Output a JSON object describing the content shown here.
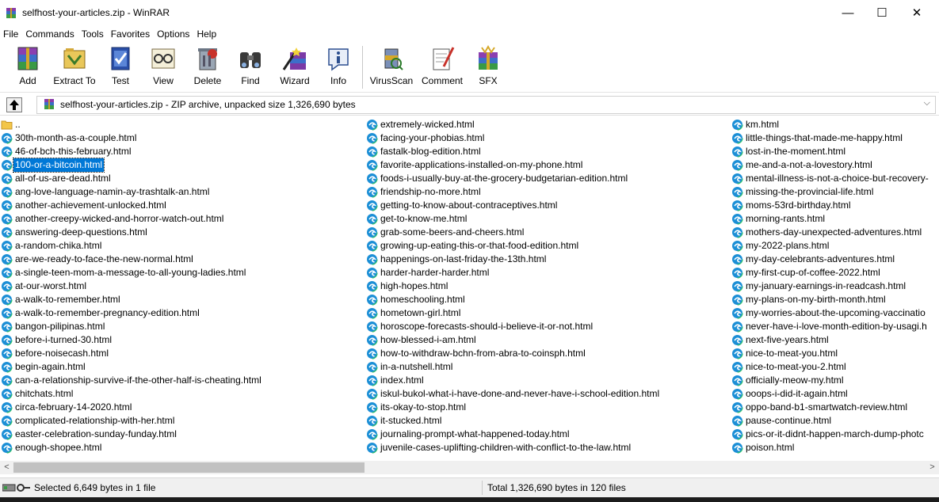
{
  "window": {
    "title": "selfhost-your-articles.zip - WinRAR",
    "minimize": "—",
    "maximize": "☐",
    "close": "✕"
  },
  "menu": [
    "File",
    "Commands",
    "Tools",
    "Favorites",
    "Options",
    "Help"
  ],
  "toolbar": [
    {
      "label": "Add",
      "icon": "add-archive-icon"
    },
    {
      "label": "Extract To",
      "icon": "extract-to-icon"
    },
    {
      "label": "Test",
      "icon": "test-icon"
    },
    {
      "label": "View",
      "icon": "view-icon"
    },
    {
      "label": "Delete",
      "icon": "delete-icon"
    },
    {
      "label": "Find",
      "icon": "find-binoculars-icon"
    },
    {
      "label": "Wizard",
      "icon": "wizard-icon"
    },
    {
      "label": "Info",
      "icon": "info-icon"
    },
    {
      "label": "VirusScan",
      "icon": "virusscan-icon"
    },
    {
      "label": "Comment",
      "icon": "comment-icon"
    },
    {
      "label": "SFX",
      "icon": "sfx-icon"
    }
  ],
  "address": {
    "text": "selfhost-your-articles.zip - ZIP archive, unpacked size 1,326,690 bytes",
    "dropdown": "⌵"
  },
  "files": {
    "col1": [
      "..",
      "30th-month-as-a-couple.html",
      "46-of-bch-this-february.html",
      "100-or-a-bitcoin.html",
      "all-of-us-are-dead.html",
      "ang-love-language-namin-ay-trashtalk-an.html",
      "another-achievement-unlocked.html",
      "another-creepy-wicked-and-horror-watch-out.html",
      "answering-deep-questions.html",
      "a-random-chika.html",
      "are-we-ready-to-face-the-new-normal.html",
      "a-single-teen-mom-a-message-to-all-young-ladies.html",
      "at-our-worst.html",
      "a-walk-to-remember.html",
      "a-walk-to-remember-pregnancy-edition.html",
      "bangon-pilipinas.html",
      "before-i-turned-30.html",
      "before-noisecash.html",
      "begin-again.html",
      "can-a-relationship-survive-if-the-other-half-is-cheating.html",
      "chitchats.html",
      "circa-february-14-2020.html",
      "complicated-relationship-with-her.html",
      "easter-celebration-sunday-funday.html",
      "enough-shopee.html"
    ],
    "col2": [
      "extremely-wicked.html",
      "facing-your-phobias.html",
      "fastalk-blog-edition.html",
      "favorite-applications-installed-on-my-phone.html",
      "foods-i-usually-buy-at-the-grocery-budgetarian-edition.html",
      "friendship-no-more.html",
      "getting-to-know-about-contraceptives.html",
      "get-to-know-me.html",
      "grab-some-beers-and-cheers.html",
      "growing-up-eating-this-or-that-food-edition.html",
      "happenings-on-last-friday-the-13th.html",
      "harder-harder-harder.html",
      "high-hopes.html",
      "homeschooling.html",
      "hometown-girl.html",
      "horoscope-forecasts-should-i-believe-it-or-not.html",
      "how-blessed-i-am.html",
      "how-to-withdraw-bchn-from-abra-to-coinsph.html",
      "in-a-nutshell.html",
      "index.html",
      "iskul-bukol-what-i-have-done-and-never-have-i-school-edition.html",
      "its-okay-to-stop.html",
      "it-stucked.html",
      "journaling-prompt-what-happened-today.html",
      "juvenile-cases-uplifting-children-with-conflict-to-the-law.html"
    ],
    "col3": [
      "km.html",
      "little-things-that-made-me-happy.html",
      "lost-in-the-moment.html",
      "me-and-a-not-a-lovestory.html",
      "mental-illness-is-not-a-choice-but-recovery-",
      "missing-the-provincial-life.html",
      "moms-53rd-birthday.html",
      "morning-rants.html",
      "mothers-day-unexpected-adventures.html",
      "my-2022-plans.html",
      "my-day-celebrants-adventures.html",
      "my-first-cup-of-coffee-2022.html",
      "my-january-earnings-in-readcash.html",
      "my-plans-on-my-birth-month.html",
      "my-worries-about-the-upcoming-vaccinatio",
      "never-have-i-love-month-edition-by-usagi.h",
      "next-five-years.html",
      "nice-to-meat-you.html",
      "nice-to-meat-you-2.html",
      "officially-meow-my.html",
      "ooops-i-did-it-again.html",
      "oppo-band-b1-smartwatch-review.html",
      "pause-continue.html",
      "pics-or-it-didnt-happen-march-dump-photc",
      "poison.html"
    ],
    "selected": "100-or-a-bitcoin.html"
  },
  "scroll": {
    "left": "<",
    "right": ">"
  },
  "status": {
    "left": "Selected 6,649 bytes in 1 file",
    "right": "Total 1,326,690 bytes in 120 files"
  }
}
